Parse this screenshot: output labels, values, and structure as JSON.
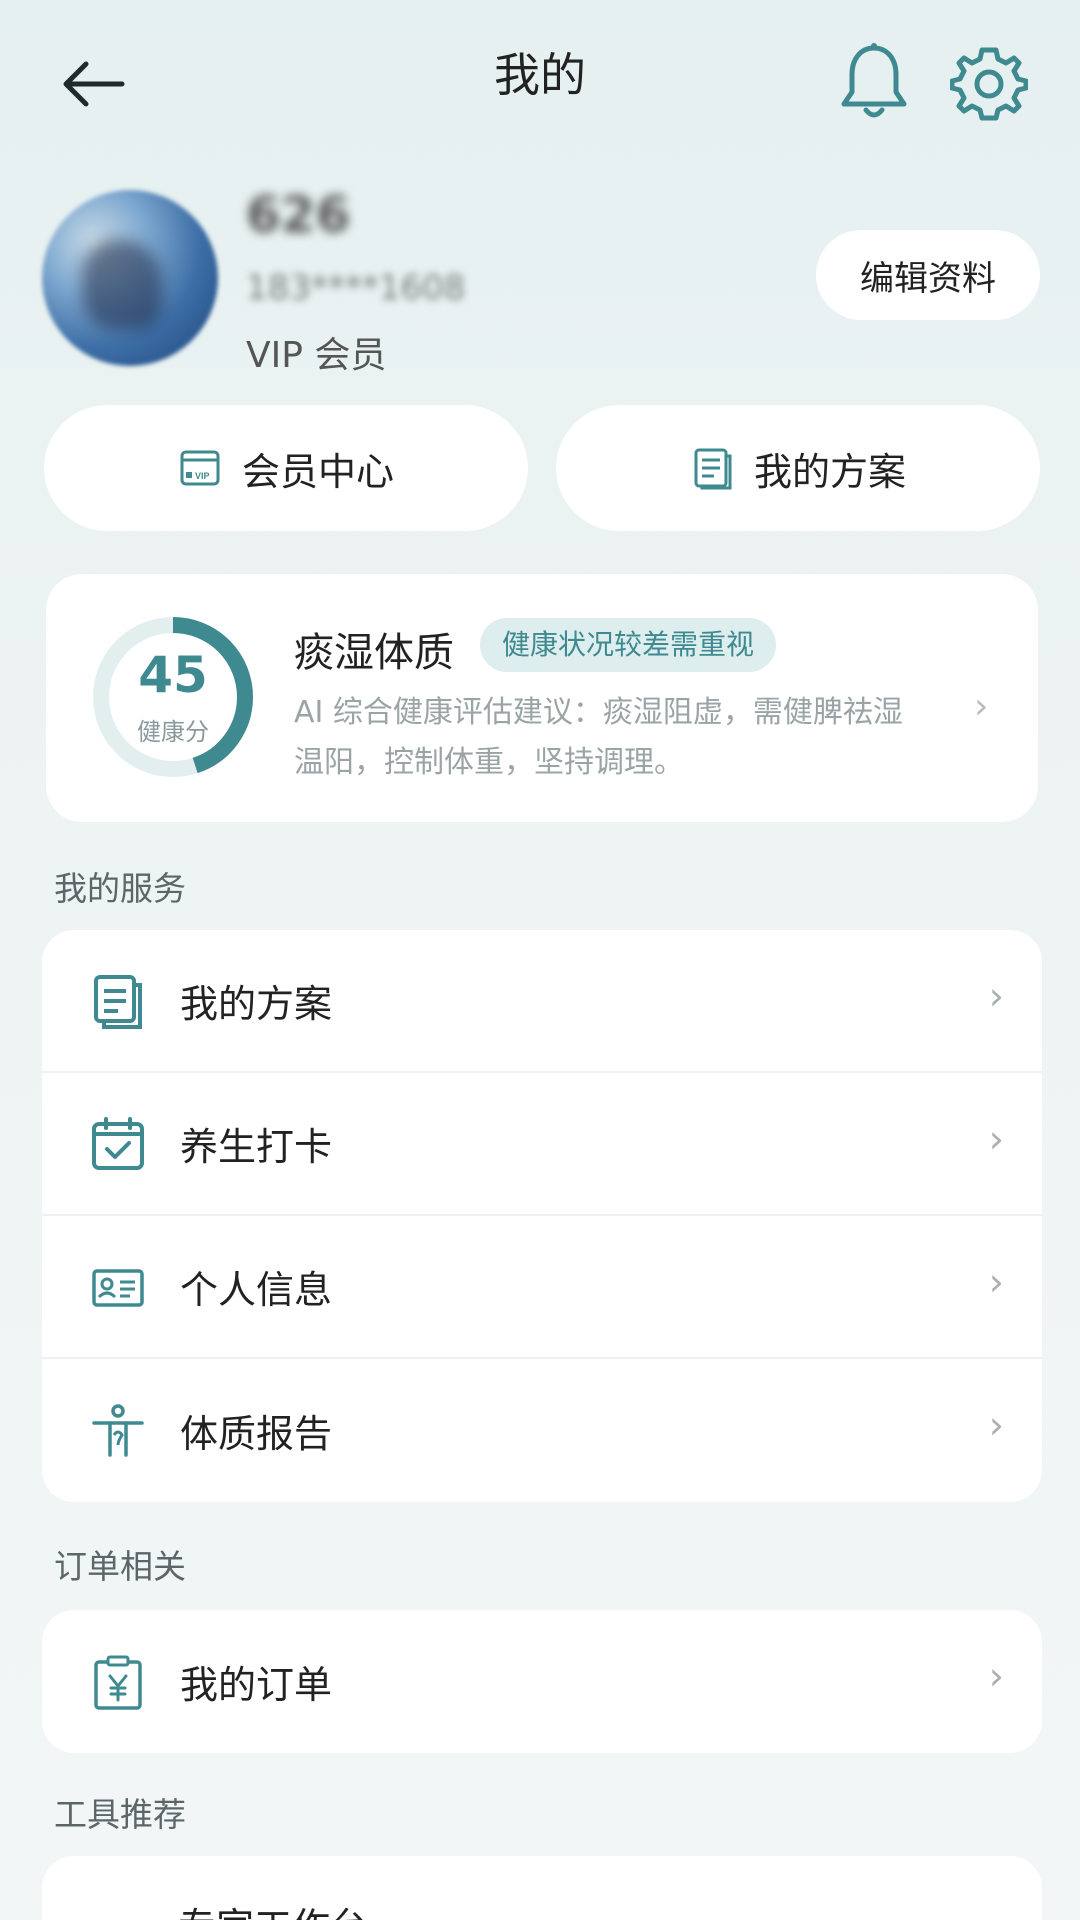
{
  "header": {
    "title": "我的"
  },
  "profile": {
    "nickname": "626",
    "phone": "183****1608",
    "member_level": "VIP 会员",
    "edit_button": "编辑资料"
  },
  "quick_actions": [
    {
      "label": "会员中心",
      "icon": "vip-card-icon"
    },
    {
      "label": "我的方案",
      "icon": "document-icon"
    }
  ],
  "health": {
    "score": "45",
    "score_label": "健康分",
    "score_fraction": 0.45,
    "constitution": "痰湿体质",
    "status_badge": "健康状况较差需重视",
    "advice_line1": "AI 综合健康评估建议：痰湿阻虚，需健脾祛湿",
    "advice_line2": "温阳，控制体重，坚持调理。"
  },
  "sections": {
    "services_title": "我的服务",
    "services": [
      {
        "label": "我的方案",
        "icon": "document-icon"
      },
      {
        "label": "养生打卡",
        "icon": "calendar-check-icon"
      },
      {
        "label": "个人信息",
        "icon": "id-card-icon"
      },
      {
        "label": "体质报告",
        "icon": "body-report-icon"
      }
    ],
    "orders_title": "订单相关",
    "orders": [
      {
        "label": "我的订单",
        "icon": "order-yuan-icon"
      }
    ],
    "tools_title": "工具推荐",
    "tools": [
      {
        "label": "专家工作台"
      }
    ]
  },
  "colors": {
    "accent": "#3e8a90",
    "ring_track": "#e3efef",
    "badge_bg": "#deeded"
  }
}
